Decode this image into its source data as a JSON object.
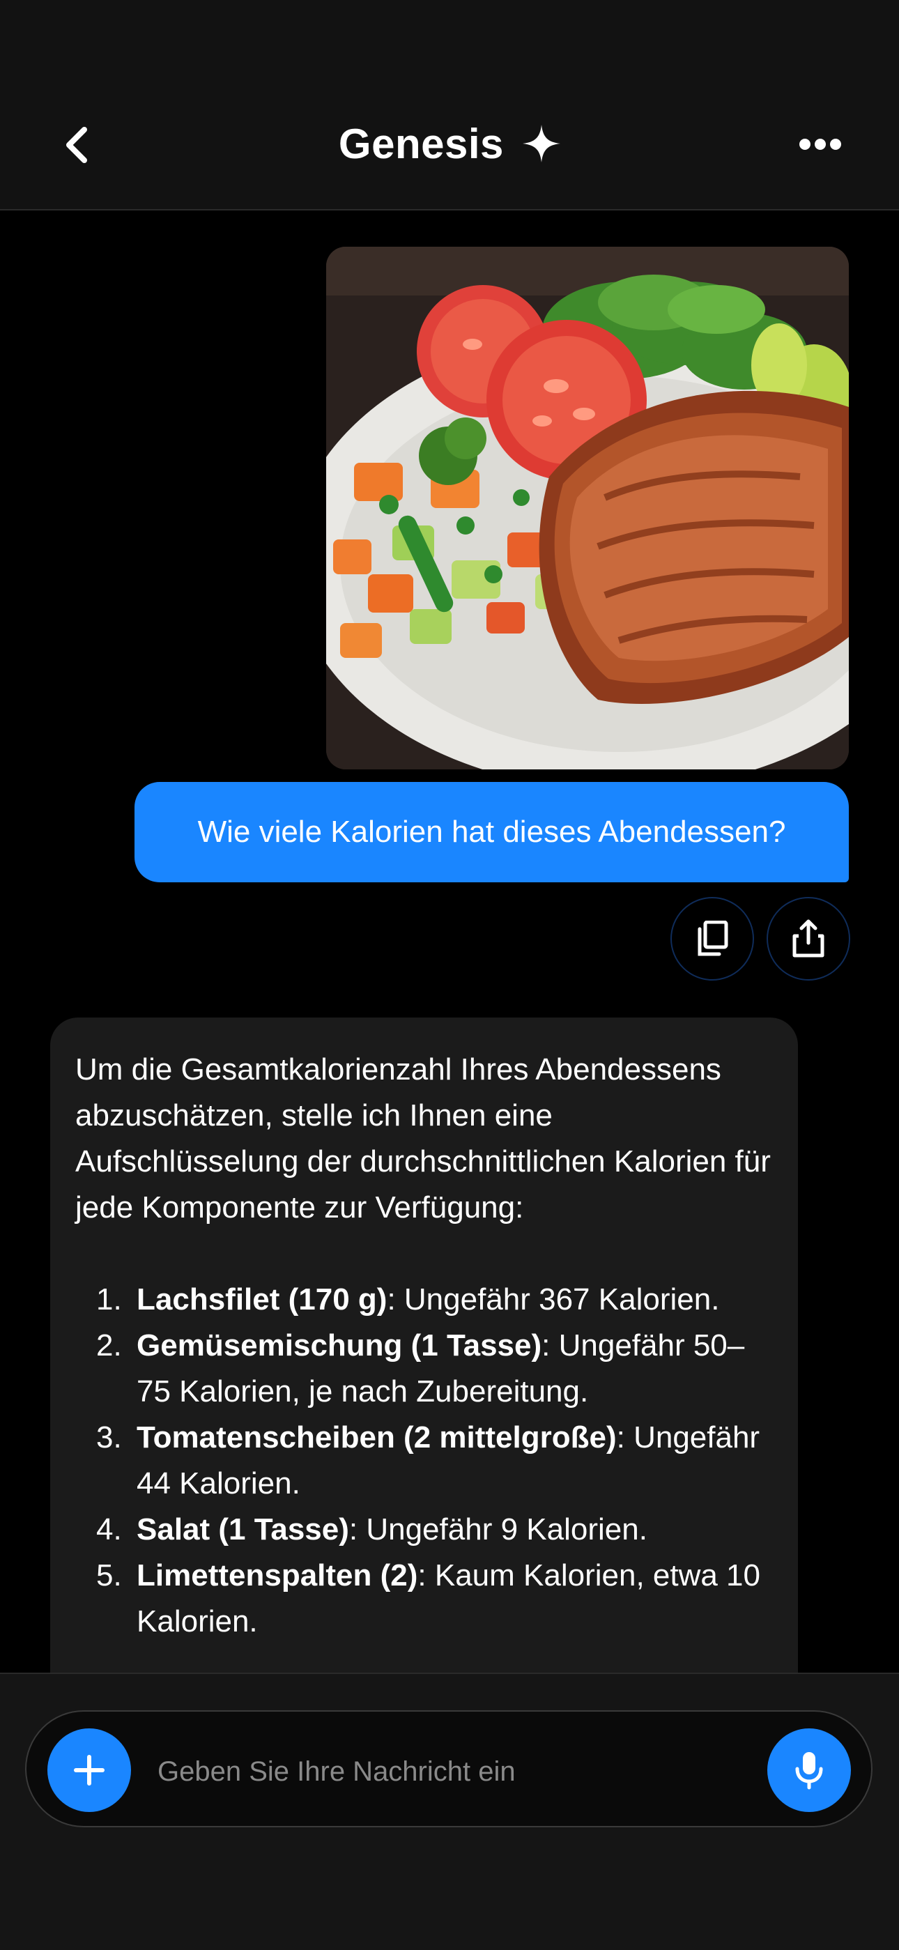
{
  "header": {
    "title": "Genesis",
    "back_icon": "chevron-left-icon",
    "title_icon": "sparkle-icon",
    "more_icon": "more-horizontal-icon"
  },
  "conversation": {
    "user_image": "dinner-plate-salmon-vegetables",
    "user_message": "Wie viele Kalorien hat dieses Abendessen?",
    "actions": [
      "copy-icon",
      "share-icon"
    ],
    "ai_response": {
      "intro": "Um die Gesamtkalorienzahl Ihres Abendessens abzuschätzen, stelle ich Ihnen eine Aufschlüsselung der durchschnittlichen Kalorien für jede Komponente zur Verfügung:",
      "items": [
        {
          "num": "1.",
          "bold": "Lachsfilet (170 g)",
          "text": ": Ungefähr 367 Kalorien."
        },
        {
          "num": "2.",
          "bold": "Gemüsemischung (1 Tasse)",
          "text": ": Ungefähr 50–75 Kalorien, je nach Zubereitung."
        },
        {
          "num": "3.",
          "bold": "Tomatenscheiben (2 mittelgroße)",
          "text": ": Ungefähr 44 Kalorien."
        },
        {
          "num": "4.",
          "bold": "Salat (1 Tasse)",
          "text": ": Ungefähr 9 Kalorien."
        },
        {
          "num": "5.",
          "bold": "Limettenspalten (2)",
          "text": ": Kaum Kalorien, etwa 10 Kalorien."
        }
      ]
    }
  },
  "composer": {
    "placeholder": "Geben Sie Ihre Nachricht ein",
    "plus_icon": "plus-icon",
    "mic_icon": "microphone-icon"
  },
  "colors": {
    "accent": "#1a86ff",
    "background": "#000000",
    "bubble": "#1b1b1b"
  }
}
